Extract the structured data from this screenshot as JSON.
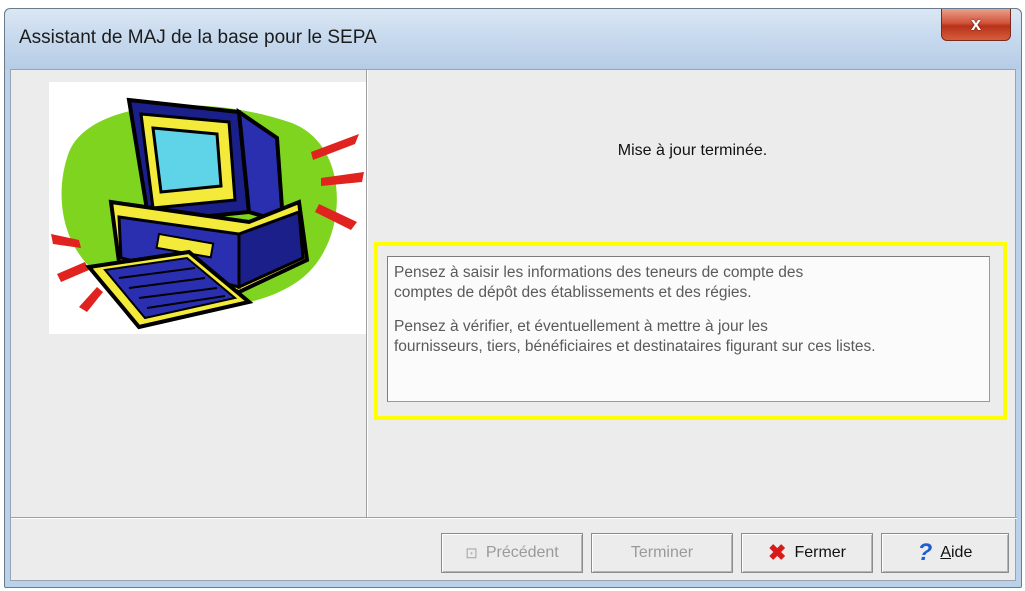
{
  "window": {
    "title": "Assistant de MAJ de la base pour le SEPA",
    "close_glyph": "x"
  },
  "illustration": {
    "icon": "computer-clipart-icon"
  },
  "status": {
    "message": "Mise à jour terminée."
  },
  "note": {
    "highlight_color": "#ffff00",
    "paragraph1_line1": "Pensez à saisir les informations des teneurs de compte des",
    "paragraph1_line2": "comptes de dépôt des établissements et des régies.",
    "paragraph2_line1": "Pensez à vérifier, et éventuellement à mettre à jour les",
    "paragraph2_line2": "fournisseurs, tiers, bénéficiaires et destinataires figurant sur ces listes."
  },
  "buttons": {
    "previous_label": "Précédent",
    "finish_label": "Terminer",
    "close_label": "Fermer",
    "help_mnemonic": "A",
    "help_rest": "ide"
  }
}
